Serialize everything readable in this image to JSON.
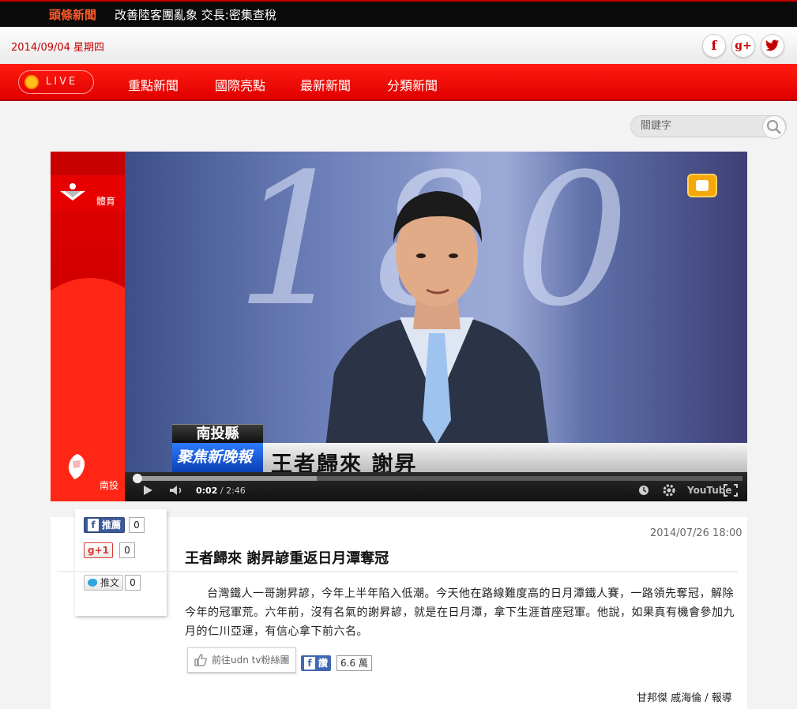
{
  "ticker": {
    "label": "頭條新聞",
    "headline": "改善陸客團亂象 交長:密集查稅"
  },
  "header": {
    "date": "2014/09/04 星期四",
    "social": [
      "f",
      "g+",
      "t"
    ]
  },
  "nav": {
    "live_label": "LIVE",
    "items": [
      "重點新聞",
      "國際亮點",
      "最新新聞",
      "分類新聞"
    ]
  },
  "search": {
    "placeholder": "關鍵字"
  },
  "video": {
    "category": "體育",
    "location": "南投",
    "lower_third": {
      "place": "南投縣",
      "program": "聚焦新晚報",
      "title": "王者歸來 謝昇"
    },
    "current_time": "0:02",
    "duration": "2:46",
    "played_fraction": 0.012,
    "buffered_fraction": 0.3,
    "brand": "YouTube"
  },
  "share": {
    "fb_label": "推薦",
    "fb_count": "0",
    "gplus_label": "g+1",
    "gplus_count": "0",
    "tw_label": "推文",
    "tw_count": "0"
  },
  "article": {
    "date": "2014/07/26 18:00",
    "title": "王者歸來 謝昇諺重返日月潭奪冠",
    "body": "台灣鐵人一哥謝昇諺，今年上半年陷入低潮。今天他在路線難度高的日月潭鐵人賽，一路領先奪冠，解除今年的冠軍荒。六年前，沒有名氣的謝昇諺，就是在日月潭，拿下生涯首座冠軍。他說，如果真有機會參加九月的仁川亞運，有信心拿下前六名。",
    "fan_button": "前往udn tv粉絲團",
    "like_label": "讚",
    "like_count": "6.6 萬",
    "byline": "甘邦傑 戚海倫 / 報導"
  },
  "colors": {
    "brand_red": "#e00000",
    "accent_orange": "#ff5a2a"
  }
}
